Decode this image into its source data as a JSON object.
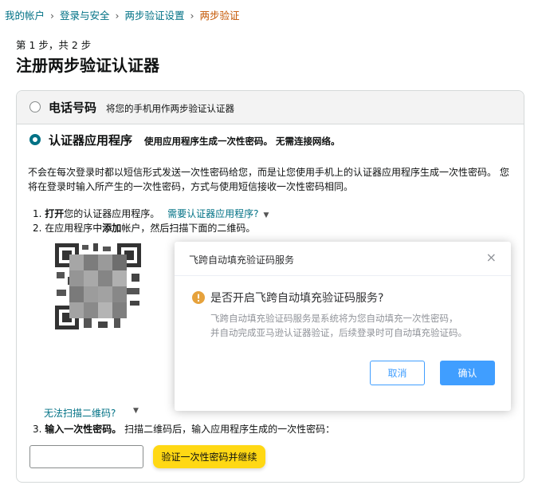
{
  "breadcrumb": {
    "items": [
      "我的帐户",
      "登录与安全",
      "两步验证设置",
      "两步验证"
    ],
    "separator": "›"
  },
  "page": {
    "step": "第 1 步，共 2 步",
    "title": "注册两步验证认证器"
  },
  "options": {
    "phone": {
      "label": "电话号码",
      "desc": "将您的手机用作两步验证认证器",
      "selected": false
    },
    "app": {
      "label": "认证器应用程序",
      "desc": "使用应用程序生成一次性密码。 无需连接网络。",
      "selected": true
    }
  },
  "description": "不会在每次登录时都以短信形式发送一次性密码给您，而是让您使用手机上的认证器应用程序生成一次性密码。 您将在登录时输入所产生的一次性密码，方式与使用短信接收一次性密码相同。",
  "steps": {
    "s1_num": "1.",
    "s1_bold": "打开",
    "s1_text": "您的认证器应用程序。",
    "s1_link": "需要认证器应用程序?",
    "s2_num": "2.",
    "s2_pre": "在应用程序中",
    "s2_bold": "添加",
    "s2_text": "帐户，然后扫描下面的二维码。",
    "cant_scan": "无法扫描二维码?",
    "s3_num": "3.",
    "s3_bold": "输入一次性密码。",
    "s3_text": " 扫描二维码后，输入应用程序生成的一次性密码："
  },
  "form": {
    "code_value": "",
    "verify_button": "验证一次性密码并继续"
  },
  "modal": {
    "header": "飞跨自动填充验证码服务",
    "close": "×",
    "title": "是否开启飞跨自动填充验证码服务?",
    "message_line1": "飞跨自动填充验证码服务是系统将为您自动填充一次性密码，",
    "message_line2": "并自动完成亚马逊认证器验证，后续登录时可自动填充验证码。",
    "cancel": "取消",
    "confirm": "确认"
  },
  "icons": {
    "warning": "warning-icon",
    "chevron": "chevron-down-icon",
    "qr": "qr-code"
  },
  "colors": {
    "link": "#007185",
    "current_crumb": "#c45500",
    "accent_button": "#ffd814",
    "modal_primary": "#409eff",
    "warning": "#e6a23c"
  }
}
